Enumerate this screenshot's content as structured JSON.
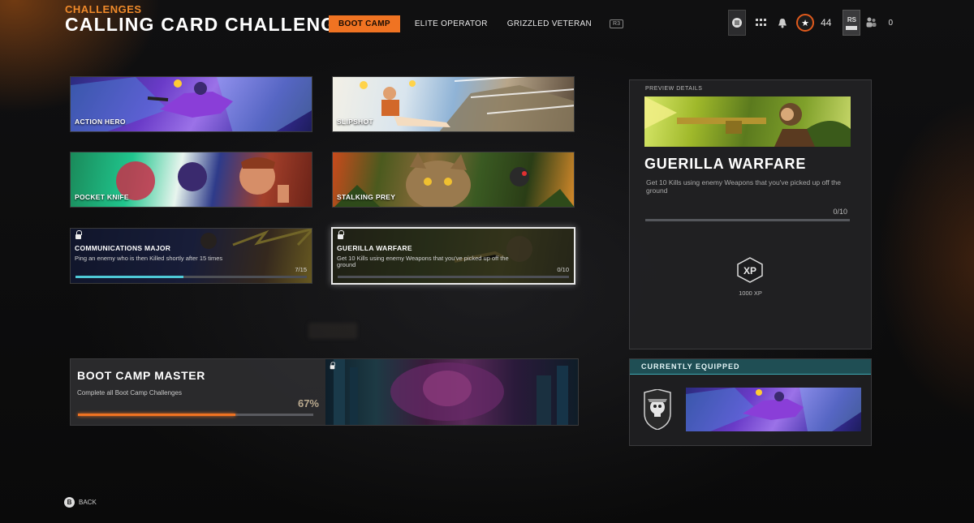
{
  "header": {
    "breadcrumb": "CHALLENGES",
    "title": "CALLING CARD CHALLENGE",
    "tabs": [
      {
        "label": "BOOT CAMP",
        "active": true
      },
      {
        "label": "ELITE OPERATOR",
        "active": false
      },
      {
        "label": "GRIZZLED VETERAN",
        "active": false
      }
    ],
    "tab_key_hint": "R3",
    "player_level": "44",
    "rs_label": "RS",
    "party_count": "0"
  },
  "cards": [
    {
      "title": "ACTION HERO",
      "locked": false
    },
    {
      "title": "SLIPSHOT",
      "locked": false
    },
    {
      "title": "POCKET KNIFE",
      "locked": false
    },
    {
      "title": "STALKING PREY",
      "locked": false
    },
    {
      "title": "COMMUNICATIONS MAJOR",
      "locked": true,
      "description": "Ping an enemy who is then Killed shortly after 15 times",
      "progress_text": "7/15",
      "progress": 0.4667
    },
    {
      "title": "GUERILLA WARFARE",
      "locked": true,
      "selected": true,
      "description": "Get 10 Kills using enemy Weapons that you've picked up off the ground",
      "progress_text": "0/10",
      "progress": 0
    }
  ],
  "preview": {
    "label": "PREVIEW DETAILS",
    "title": "GUERILLA WARFARE",
    "description": "Get 10 Kills using enemy Weapons that you've picked up off the ground",
    "progress_text": "0/10",
    "progress": 0,
    "reward_icon": "XP",
    "reward_amount": "1000 XP"
  },
  "master": {
    "title": "BOOT CAMP MASTER",
    "description": "Complete all Boot Camp Challenges",
    "percent": "67%",
    "progress": 0.67
  },
  "equipped": {
    "label": "CURRENTLY EQUIPPED"
  },
  "footer": {
    "back_button": "B",
    "back_label": "BACK"
  },
  "colors": {
    "accent": "#f07322",
    "progress_cyan": "#4ec9d6",
    "equipped_header": "#1f4e54"
  }
}
